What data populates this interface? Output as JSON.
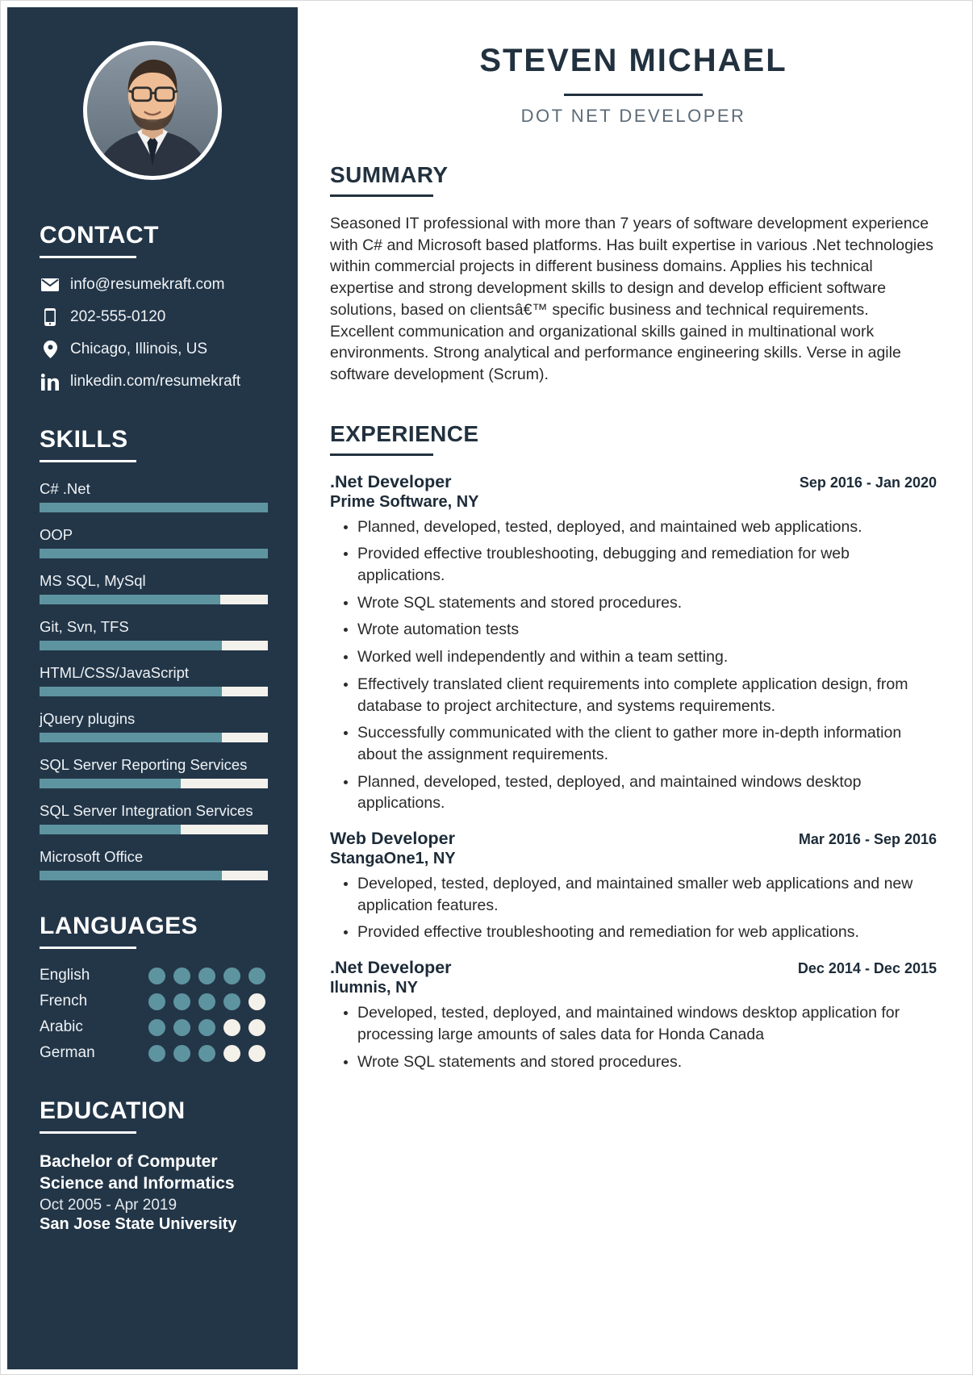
{
  "colors": {
    "sidebar_bg": "#233648",
    "accent": "#5e94a0",
    "track": "#f3f1ec",
    "heading": "#22313f"
  },
  "header": {
    "name": "STEVEN MICHAEL",
    "role": "DOT NET DEVELOPER"
  },
  "contact": {
    "heading": "CONTACT",
    "items": [
      {
        "icon": "envelope-icon",
        "text": "info@resumekraft.com"
      },
      {
        "icon": "mobile-phone-icon",
        "text": "202-555-0120"
      },
      {
        "icon": "location-pin-icon",
        "text": "Chicago, Illinois, US"
      },
      {
        "icon": "linkedin-icon",
        "text": "linkedin.com/resumekraft"
      }
    ]
  },
  "skills": {
    "heading": "SKILLS",
    "items": [
      {
        "name": "C# .Net",
        "level": 100
      },
      {
        "name": "OOP",
        "level": 100
      },
      {
        "name": "MS SQL, MySql",
        "level": 79
      },
      {
        "name": "Git, Svn, TFS",
        "level": 80
      },
      {
        "name": "HTML/CSS/JavaScript",
        "level": 80
      },
      {
        "name": "jQuery plugins",
        "level": 80
      },
      {
        "name": "SQL Server Reporting Services",
        "level": 62
      },
      {
        "name": "SQL Server Integration Services",
        "level": 62
      },
      {
        "name": "Microsoft Office",
        "level": 80
      }
    ]
  },
  "languages": {
    "heading": "LANGUAGES",
    "max_dots": 5,
    "items": [
      {
        "name": "English",
        "level": 5
      },
      {
        "name": "French",
        "level": 4
      },
      {
        "name": "Arabic",
        "level": 3
      },
      {
        "name": "German",
        "level": 3
      }
    ]
  },
  "education": {
    "heading": "EDUCATION",
    "items": [
      {
        "degree": "Bachelor of Computer Science and Informatics",
        "date": "Oct 2005 - Apr 2019",
        "school": "San Jose State University"
      }
    ]
  },
  "summary": {
    "heading": "SUMMARY",
    "text": "Seasoned IT professional with more than 7 years of software development experience with C# and Microsoft based platforms. Has built expertise in various .Net technologies within commercial projects in different business domains. Applies his technical expertise and strong development skills to design and develop efficient software solutions, based on clientsâ€™ specific business and technical requirements. Excellent communication and organizational skills gained in multinational work environments. Strong analytical and performance engineering skills. Verse in agile software development (Scrum)."
  },
  "experience": {
    "heading": "EXPERIENCE",
    "jobs": [
      {
        "title": ".Net Developer",
        "date": "Sep 2016 - Jan 2020",
        "company": "Prime Software, NY",
        "bullets": [
          "Planned, developed, tested, deployed, and maintained web applications.",
          "Provided effective troubleshooting, debugging and remediation for web applications.",
          "Wrote SQL statements and stored procedures.",
          "Wrote automation tests",
          "Worked well independently and within a team setting.",
          "Effectively translated client requirements into complete application design, from database to project architecture, and systems requirements.",
          "Successfully communicated with the client to gather more in-depth information about the assignment requirements.",
          "Planned, developed, tested, deployed, and maintained windows desktop applications."
        ]
      },
      {
        "title": "Web Developer",
        "date": "Mar 2016 - Sep 2016",
        "company": "StangaOne1, NY",
        "bullets": [
          "Developed, tested, deployed, and maintained smaller web applications and new application features.",
          "Provided effective troubleshooting and remediation for web applications."
        ]
      },
      {
        "title": ".Net Developer",
        "date": "Dec 2014 - Dec 2015",
        "company": "Ilumnis, NY",
        "bullets": [
          "Developed, tested, deployed, and maintained windows desktop application for processing large amounts of sales data for Honda Canada",
          "Wrote SQL statements and stored procedures."
        ]
      }
    ]
  }
}
